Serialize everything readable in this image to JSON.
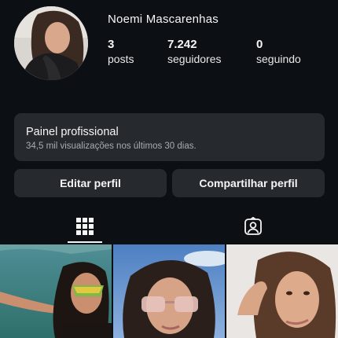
{
  "profile": {
    "name": "Noemi Mascarenhas",
    "avatar": "profile-photo"
  },
  "stats": {
    "posts": {
      "value": "3",
      "label": "posts"
    },
    "followers": {
      "value": "7.242",
      "label": "seguidores"
    },
    "following": {
      "value": "0",
      "label": "seguindo"
    }
  },
  "professional_panel": {
    "title": "Painel profissional",
    "subtitle": "34,5 mil visualizações nos últimos 30 dias."
  },
  "actions": {
    "edit": "Editar perfil",
    "share": "Compartilhar perfil"
  },
  "tabs": [
    {
      "icon": "grid-icon",
      "selected": true
    },
    {
      "icon": "tagged-person-icon",
      "selected": false
    }
  ],
  "grid": [
    {
      "type": "photo",
      "description_icon": "post-thumbnail"
    },
    {
      "type": "photo",
      "description_icon": "post-thumbnail"
    },
    {
      "type": "photo",
      "description_icon": "post-thumbnail"
    }
  ],
  "colors": {
    "background": "#0c1014",
    "card": "#262a2f",
    "text": "#f5f5f5",
    "muted": "#a9acb0"
  }
}
